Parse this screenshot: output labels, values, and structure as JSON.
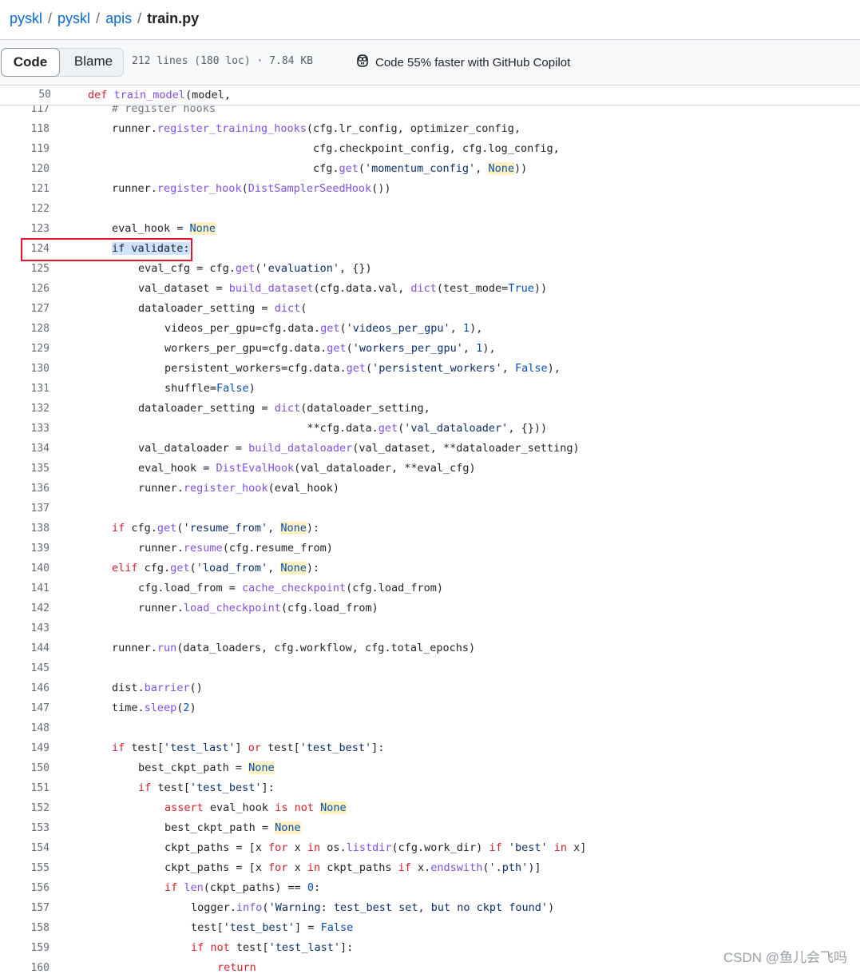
{
  "breadcrumb": {
    "root": "pyskl",
    "dir1": "pyskl",
    "dir2": "apis",
    "file": "train.py",
    "separator": "/"
  },
  "toolbar": {
    "code_tab": "Code",
    "blame_tab": "Blame",
    "file_info": "212 lines (180 loc) · 7.84 KB",
    "copilot_text": "Code 55% faster with GitHub Copilot",
    "copilot_icon": "copilot-icon"
  },
  "sticky_header": {
    "line_no": "50",
    "keyword": "def",
    "func_name": "train_model",
    "rest": "(model,"
  },
  "code_lines": [
    {
      "n": "117",
      "indent": 1,
      "t": [
        [
          "cmt",
          "# register hooks"
        ]
      ]
    },
    {
      "n": "118",
      "indent": 1,
      "t": [
        [
          "p",
          "runner."
        ],
        [
          "fn",
          "register_training_hooks"
        ],
        [
          "p",
          "(cfg.lr_config, optimizer_config,"
        ]
      ]
    },
    {
      "n": "119",
      "indent": 1,
      "t": [
        [
          "p",
          "                               cfg.checkpoint_config, cfg.log_config,"
        ]
      ]
    },
    {
      "n": "120",
      "indent": 1,
      "t": [
        [
          "p",
          "                               cfg."
        ],
        [
          "fn",
          "get"
        ],
        [
          "p",
          "("
        ],
        [
          "str",
          "'momentum_config'"
        ],
        [
          "p",
          ", "
        ],
        [
          "cst",
          "None"
        ],
        [
          "p",
          "))"
        ]
      ]
    },
    {
      "n": "121",
      "indent": 1,
      "t": [
        [
          "p",
          "runner."
        ],
        [
          "fn",
          "register_hook"
        ],
        [
          "p",
          "("
        ],
        [
          "fn",
          "DistSamplerSeedHook"
        ],
        [
          "p",
          "())"
        ]
      ]
    },
    {
      "n": "122",
      "indent": 0,
      "t": []
    },
    {
      "n": "123",
      "indent": 1,
      "t": [
        [
          "p",
          "eval_hook = "
        ],
        [
          "cst",
          "None"
        ]
      ]
    },
    {
      "n": "124",
      "indent": 1,
      "t": [
        [
          "sel",
          "if validate:"
        ]
      ]
    },
    {
      "n": "125",
      "indent": 2,
      "t": [
        [
          "p",
          "eval_cfg = cfg."
        ],
        [
          "fn",
          "get"
        ],
        [
          "p",
          "("
        ],
        [
          "str",
          "'evaluation'"
        ],
        [
          "p",
          ", {})"
        ]
      ]
    },
    {
      "n": "126",
      "indent": 2,
      "t": [
        [
          "p",
          "val_dataset = "
        ],
        [
          "fn",
          "build_dataset"
        ],
        [
          "p",
          "(cfg.data.val, "
        ],
        [
          "fn",
          "dict"
        ],
        [
          "p",
          "(test_mode="
        ],
        [
          "num",
          "True"
        ],
        [
          "p",
          "))"
        ]
      ]
    },
    {
      "n": "127",
      "indent": 2,
      "t": [
        [
          "p",
          "dataloader_setting = "
        ],
        [
          "fn",
          "dict"
        ],
        [
          "p",
          "("
        ]
      ]
    },
    {
      "n": "128",
      "indent": 3,
      "t": [
        [
          "p",
          "videos_per_gpu=cfg.data."
        ],
        [
          "fn",
          "get"
        ],
        [
          "p",
          "("
        ],
        [
          "str",
          "'videos_per_gpu'"
        ],
        [
          "p",
          ", "
        ],
        [
          "num",
          "1"
        ],
        [
          "p",
          "),"
        ]
      ]
    },
    {
      "n": "129",
      "indent": 3,
      "t": [
        [
          "p",
          "workers_per_gpu=cfg.data."
        ],
        [
          "fn",
          "get"
        ],
        [
          "p",
          "("
        ],
        [
          "str",
          "'workers_per_gpu'"
        ],
        [
          "p",
          ", "
        ],
        [
          "num",
          "1"
        ],
        [
          "p",
          "),"
        ]
      ]
    },
    {
      "n": "130",
      "indent": 3,
      "t": [
        [
          "p",
          "persistent_workers=cfg.data."
        ],
        [
          "fn",
          "get"
        ],
        [
          "p",
          "("
        ],
        [
          "str",
          "'persistent_workers'"
        ],
        [
          "p",
          ", "
        ],
        [
          "num",
          "False"
        ],
        [
          "p",
          "),"
        ]
      ]
    },
    {
      "n": "131",
      "indent": 3,
      "t": [
        [
          "p",
          "shuffle="
        ],
        [
          "num",
          "False"
        ],
        [
          "p",
          ")"
        ]
      ]
    },
    {
      "n": "132",
      "indent": 2,
      "t": [
        [
          "p",
          "dataloader_setting = "
        ],
        [
          "fn",
          "dict"
        ],
        [
          "p",
          "(dataloader_setting,"
        ]
      ]
    },
    {
      "n": "133",
      "indent": 2,
      "t": [
        [
          "p",
          "                          **cfg.data."
        ],
        [
          "fn",
          "get"
        ],
        [
          "p",
          "("
        ],
        [
          "str",
          "'val_dataloader'"
        ],
        [
          "p",
          ", {}))"
        ]
      ]
    },
    {
      "n": "134",
      "indent": 2,
      "t": [
        [
          "p",
          "val_dataloader = "
        ],
        [
          "fn",
          "build_dataloader"
        ],
        [
          "p",
          "(val_dataset, **dataloader_setting)"
        ]
      ]
    },
    {
      "n": "135",
      "indent": 2,
      "t": [
        [
          "p",
          "eval_hook = "
        ],
        [
          "fn",
          "DistEvalHook"
        ],
        [
          "p",
          "(val_dataloader, **eval_cfg)"
        ]
      ]
    },
    {
      "n": "136",
      "indent": 2,
      "t": [
        [
          "p",
          "runner."
        ],
        [
          "fn",
          "register_hook"
        ],
        [
          "p",
          "(eval_hook)"
        ]
      ]
    },
    {
      "n": "137",
      "indent": 0,
      "t": []
    },
    {
      "n": "138",
      "indent": 1,
      "t": [
        [
          "kw",
          "if"
        ],
        [
          "p",
          " cfg."
        ],
        [
          "fn",
          "get"
        ],
        [
          "p",
          "("
        ],
        [
          "str",
          "'resume_from'"
        ],
        [
          "p",
          ", "
        ],
        [
          "cst",
          "None"
        ],
        [
          "p",
          "):"
        ]
      ]
    },
    {
      "n": "139",
      "indent": 2,
      "t": [
        [
          "p",
          "runner."
        ],
        [
          "fn",
          "resume"
        ],
        [
          "p",
          "(cfg.resume_from)"
        ]
      ]
    },
    {
      "n": "140",
      "indent": 1,
      "t": [
        [
          "kw",
          "elif"
        ],
        [
          "p",
          " cfg."
        ],
        [
          "fn",
          "get"
        ],
        [
          "p",
          "("
        ],
        [
          "str",
          "'load_from'"
        ],
        [
          "p",
          ", "
        ],
        [
          "cst",
          "None"
        ],
        [
          "p",
          "):"
        ]
      ]
    },
    {
      "n": "141",
      "indent": 2,
      "t": [
        [
          "p",
          "cfg.load_from = "
        ],
        [
          "fn",
          "cache_checkpoint"
        ],
        [
          "p",
          "(cfg.load_from)"
        ]
      ]
    },
    {
      "n": "142",
      "indent": 2,
      "t": [
        [
          "p",
          "runner."
        ],
        [
          "fn",
          "load_checkpoint"
        ],
        [
          "p",
          "(cfg.load_from)"
        ]
      ]
    },
    {
      "n": "143",
      "indent": 0,
      "t": []
    },
    {
      "n": "144",
      "indent": 1,
      "t": [
        [
          "p",
          "runner."
        ],
        [
          "fn",
          "run"
        ],
        [
          "p",
          "(data_loaders, cfg.workflow, cfg.total_epochs)"
        ]
      ]
    },
    {
      "n": "145",
      "indent": 0,
      "t": []
    },
    {
      "n": "146",
      "indent": 1,
      "t": [
        [
          "p",
          "dist."
        ],
        [
          "fn",
          "barrier"
        ],
        [
          "p",
          "()"
        ]
      ]
    },
    {
      "n": "147",
      "indent": 1,
      "t": [
        [
          "p",
          "time."
        ],
        [
          "fn",
          "sleep"
        ],
        [
          "p",
          "("
        ],
        [
          "num",
          "2"
        ],
        [
          "p",
          ")"
        ]
      ]
    },
    {
      "n": "148",
      "indent": 0,
      "t": []
    },
    {
      "n": "149",
      "indent": 1,
      "t": [
        [
          "kw",
          "if"
        ],
        [
          "p",
          " test["
        ],
        [
          "str",
          "'test_last'"
        ],
        [
          "p",
          "] "
        ],
        [
          "kw",
          "or"
        ],
        [
          "p",
          " test["
        ],
        [
          "str",
          "'test_best'"
        ],
        [
          "p",
          "]:"
        ]
      ]
    },
    {
      "n": "150",
      "indent": 2,
      "t": [
        [
          "p",
          "best_ckpt_path = "
        ],
        [
          "cst",
          "None"
        ]
      ]
    },
    {
      "n": "151",
      "indent": 2,
      "t": [
        [
          "kw",
          "if"
        ],
        [
          "p",
          " test["
        ],
        [
          "str",
          "'test_best'"
        ],
        [
          "p",
          "]:"
        ]
      ]
    },
    {
      "n": "152",
      "indent": 3,
      "t": [
        [
          "kw",
          "assert"
        ],
        [
          "p",
          " eval_hook "
        ],
        [
          "kw",
          "is not"
        ],
        [
          "p",
          " "
        ],
        [
          "cst",
          "None"
        ]
      ]
    },
    {
      "n": "153",
      "indent": 3,
      "t": [
        [
          "p",
          "best_ckpt_path = "
        ],
        [
          "cst",
          "None"
        ]
      ]
    },
    {
      "n": "154",
      "indent": 3,
      "t": [
        [
          "p",
          "ckpt_paths = [x "
        ],
        [
          "kw",
          "for"
        ],
        [
          "p",
          " x "
        ],
        [
          "kw",
          "in"
        ],
        [
          "p",
          " os."
        ],
        [
          "fn",
          "listdir"
        ],
        [
          "p",
          "(cfg.work_dir) "
        ],
        [
          "kw",
          "if"
        ],
        [
          "p",
          " "
        ],
        [
          "str",
          "'best'"
        ],
        [
          "p",
          " "
        ],
        [
          "kw",
          "in"
        ],
        [
          "p",
          " x]"
        ]
      ]
    },
    {
      "n": "155",
      "indent": 3,
      "t": [
        [
          "p",
          "ckpt_paths = [x "
        ],
        [
          "kw",
          "for"
        ],
        [
          "p",
          " x "
        ],
        [
          "kw",
          "in"
        ],
        [
          "p",
          " ckpt_paths "
        ],
        [
          "kw",
          "if"
        ],
        [
          "p",
          " x."
        ],
        [
          "fn",
          "endswith"
        ],
        [
          "p",
          "("
        ],
        [
          "str",
          "'.pth'"
        ],
        [
          "p",
          ")]"
        ]
      ]
    },
    {
      "n": "156",
      "indent": 3,
      "t": [
        [
          "kw",
          "if"
        ],
        [
          "p",
          " "
        ],
        [
          "fn",
          "len"
        ],
        [
          "p",
          "(ckpt_paths) == "
        ],
        [
          "num",
          "0"
        ],
        [
          "p",
          ":"
        ]
      ]
    },
    {
      "n": "157",
      "indent": 4,
      "t": [
        [
          "p",
          "logger."
        ],
        [
          "fn",
          "info"
        ],
        [
          "p",
          "("
        ],
        [
          "str",
          "'Warning: test_best set, but no ckpt found'"
        ],
        [
          "p",
          ")"
        ]
      ]
    },
    {
      "n": "158",
      "indent": 4,
      "t": [
        [
          "p",
          "test["
        ],
        [
          "str",
          "'test_best'"
        ],
        [
          "p",
          "] = "
        ],
        [
          "num",
          "False"
        ]
      ]
    },
    {
      "n": "159",
      "indent": 4,
      "t": [
        [
          "kw",
          "if not"
        ],
        [
          "p",
          " test["
        ],
        [
          "str",
          "'test_last'"
        ],
        [
          "p",
          "]:"
        ]
      ]
    },
    {
      "n": "160",
      "indent": 5,
      "t": [
        [
          "kw",
          "return"
        ]
      ]
    }
  ],
  "watermark": "CSDN @鱼儿会飞吗"
}
